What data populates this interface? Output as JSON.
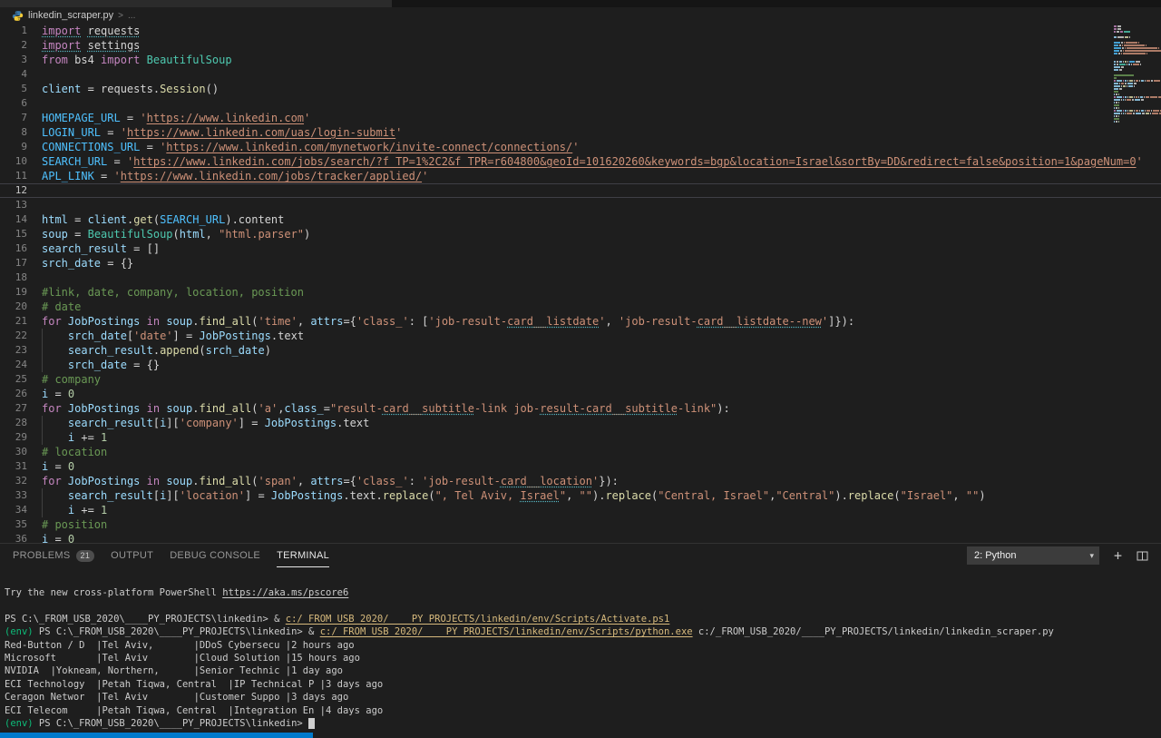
{
  "colors": {
    "accent": "#007acc",
    "kw": "#c586c0",
    "pln": "#d4d4d4",
    "var": "#9cdcfe",
    "const": "#4fc1ff",
    "fn": "#dcdcaa",
    "str": "#ce9178",
    "cmt": "#6a9955",
    "num": "#b5cea8",
    "cls": "#4ec9b0",
    "term_text": "#cccccc",
    "term_yellow": "#d7ba7d",
    "term_green": "#0dbc79"
  },
  "breadcrumb": {
    "file": "linkedin_scraper.py",
    "separator": ">",
    "more": "..."
  },
  "editor": {
    "current_line": 12,
    "lines": [
      [
        [
          "kw sq",
          "import"
        ],
        [
          "pln",
          " "
        ],
        [
          "pln sq",
          "requests"
        ]
      ],
      [
        [
          "kw sq",
          "import"
        ],
        [
          "pln",
          " "
        ],
        [
          "pln sq",
          "settings"
        ]
      ],
      [
        [
          "kw",
          "from"
        ],
        [
          "pln",
          " bs4 "
        ],
        [
          "kw",
          "import"
        ],
        [
          "pln",
          " "
        ],
        [
          "cls",
          "BeautifulSoup"
        ]
      ],
      [],
      [
        [
          "var",
          "client"
        ],
        [
          "pln",
          " = requests."
        ],
        [
          "fn",
          "Session"
        ],
        [
          "pln",
          "()"
        ]
      ],
      [],
      [
        [
          "const",
          "HOMEPAGE_URL"
        ],
        [
          "pln",
          " = "
        ],
        [
          "str",
          "'"
        ],
        [
          "str u",
          "https://www.linkedin.com"
        ],
        [
          "str",
          "'"
        ]
      ],
      [
        [
          "const",
          "LOGIN_URL"
        ],
        [
          "pln",
          " = "
        ],
        [
          "str",
          "'"
        ],
        [
          "str u",
          "https://www.linkedin.com/uas/login-submit"
        ],
        [
          "str",
          "'"
        ]
      ],
      [
        [
          "const",
          "CONNECTIONS_URL"
        ],
        [
          "pln",
          " = "
        ],
        [
          "str",
          "'"
        ],
        [
          "str u",
          "https://www.linkedin.com/mynetwork/invite-connect/connections/"
        ],
        [
          "str",
          "'"
        ]
      ],
      [
        [
          "const",
          "SEARCH_URL"
        ],
        [
          "pln",
          " = "
        ],
        [
          "str",
          "'"
        ],
        [
          "str u",
          "https://www.linkedin.com/jobs/search/?f_TP=1%2C2&f_TPR=r604800&geoId=101620260&keywords=bgp&location=Israel&sortBy=DD&redirect=false&position=1&pageNum=0"
        ],
        [
          "str",
          "'"
        ]
      ],
      [
        [
          "const",
          "APL_LINK"
        ],
        [
          "pln",
          " = "
        ],
        [
          "str",
          "'"
        ],
        [
          "str u",
          "https://www.linkedin.com/jobs/tracker/applied/"
        ],
        [
          "str",
          "'"
        ]
      ],
      [],
      [],
      [
        [
          "var",
          "html"
        ],
        [
          "pln",
          " = "
        ],
        [
          "var",
          "client"
        ],
        [
          "pln",
          "."
        ],
        [
          "fn",
          "get"
        ],
        [
          "pln",
          "("
        ],
        [
          "const",
          "SEARCH_URL"
        ],
        [
          "pln",
          ").content"
        ]
      ],
      [
        [
          "var",
          "soup"
        ],
        [
          "pln",
          " = "
        ],
        [
          "cls",
          "BeautifulSoup"
        ],
        [
          "pln",
          "("
        ],
        [
          "var",
          "html"
        ],
        [
          "pln",
          ", "
        ],
        [
          "str",
          "\"html.parser\""
        ],
        [
          "pln",
          ")"
        ]
      ],
      [
        [
          "var",
          "search_result"
        ],
        [
          "pln",
          " = []"
        ]
      ],
      [
        [
          "var",
          "srch_date"
        ],
        [
          "pln",
          " = {}"
        ]
      ],
      [],
      [
        [
          "cmt",
          "#link, date, company, location, position"
        ]
      ],
      [
        [
          "cmt",
          "# date"
        ]
      ],
      [
        [
          "kw",
          "for"
        ],
        [
          "pln",
          " "
        ],
        [
          "var",
          "JobPostings"
        ],
        [
          "pln",
          " "
        ],
        [
          "kw",
          "in"
        ],
        [
          "pln",
          " "
        ],
        [
          "var",
          "soup"
        ],
        [
          "pln",
          "."
        ],
        [
          "fn",
          "find_all"
        ],
        [
          "pln",
          "("
        ],
        [
          "str",
          "'time'"
        ],
        [
          "pln",
          ", "
        ],
        [
          "var",
          "attrs"
        ],
        [
          "pln",
          "={"
        ],
        [
          "str",
          "'class_'"
        ],
        [
          "pln",
          ": ["
        ],
        [
          "str",
          "'job-result-"
        ],
        [
          "str sq",
          "card__listdate"
        ],
        [
          "str",
          "'"
        ],
        [
          "pln",
          ", "
        ],
        [
          "str",
          "'job-result-"
        ],
        [
          "str sq",
          "card__listdate--new"
        ],
        [
          "str",
          "'"
        ],
        [
          "pln",
          "]}):"
        ]
      ],
      [
        [
          "pln",
          "    "
        ],
        [
          "var",
          "srch_date"
        ],
        [
          "pln",
          "["
        ],
        [
          "str",
          "'date'"
        ],
        [
          "pln",
          "] = "
        ],
        [
          "var",
          "JobPostings"
        ],
        [
          "pln",
          ".text"
        ]
      ],
      [
        [
          "pln",
          "    "
        ],
        [
          "var",
          "search_result"
        ],
        [
          "pln",
          "."
        ],
        [
          "fn",
          "append"
        ],
        [
          "pln",
          "("
        ],
        [
          "var",
          "srch_date"
        ],
        [
          "pln",
          ")"
        ]
      ],
      [
        [
          "pln",
          "    "
        ],
        [
          "var",
          "srch_date"
        ],
        [
          "pln",
          " = {}"
        ]
      ],
      [
        [
          "cmt",
          "# company"
        ]
      ],
      [
        [
          "var",
          "i"
        ],
        [
          "pln",
          " = "
        ],
        [
          "num",
          "0"
        ]
      ],
      [
        [
          "kw",
          "for"
        ],
        [
          "pln",
          " "
        ],
        [
          "var",
          "JobPostings"
        ],
        [
          "pln",
          " "
        ],
        [
          "kw",
          "in"
        ],
        [
          "pln",
          " "
        ],
        [
          "var",
          "soup"
        ],
        [
          "pln",
          "."
        ],
        [
          "fn",
          "find_all"
        ],
        [
          "pln",
          "("
        ],
        [
          "str",
          "'a'"
        ],
        [
          "pln",
          ","
        ],
        [
          "var",
          "class_"
        ],
        [
          "pln",
          "="
        ],
        [
          "str",
          "\"result-"
        ],
        [
          "str sq",
          "card__subtitle"
        ],
        [
          "str",
          "-link job-"
        ],
        [
          "str sq",
          "result-card__subtitle"
        ],
        [
          "str",
          "-link\""
        ],
        [
          "pln",
          "):"
        ]
      ],
      [
        [
          "pln",
          "    "
        ],
        [
          "var",
          "search_result"
        ],
        [
          "pln",
          "["
        ],
        [
          "var",
          "i"
        ],
        [
          "pln",
          "]["
        ],
        [
          "str",
          "'company'"
        ],
        [
          "pln",
          "] = "
        ],
        [
          "var",
          "JobPostings"
        ],
        [
          "pln",
          ".text"
        ]
      ],
      [
        [
          "pln",
          "    "
        ],
        [
          "var",
          "i"
        ],
        [
          "pln",
          " += "
        ],
        [
          "num",
          "1"
        ]
      ],
      [
        [
          "cmt",
          "# location"
        ]
      ],
      [
        [
          "var",
          "i"
        ],
        [
          "pln",
          " = "
        ],
        [
          "num",
          "0"
        ]
      ],
      [
        [
          "kw",
          "for"
        ],
        [
          "pln",
          " "
        ],
        [
          "var",
          "JobPostings"
        ],
        [
          "pln",
          " "
        ],
        [
          "kw",
          "in"
        ],
        [
          "pln",
          " "
        ],
        [
          "var",
          "soup"
        ],
        [
          "pln",
          "."
        ],
        [
          "fn",
          "find_all"
        ],
        [
          "pln",
          "("
        ],
        [
          "str",
          "'span'"
        ],
        [
          "pln",
          ", "
        ],
        [
          "var",
          "attrs"
        ],
        [
          "pln",
          "={"
        ],
        [
          "str",
          "'class_'"
        ],
        [
          "pln",
          ": "
        ],
        [
          "str",
          "'job-result-"
        ],
        [
          "str sq",
          "card__location"
        ],
        [
          "str",
          "'"
        ],
        [
          "pln",
          "}):"
        ]
      ],
      [
        [
          "pln",
          "    "
        ],
        [
          "var",
          "search_result"
        ],
        [
          "pln",
          "["
        ],
        [
          "var",
          "i"
        ],
        [
          "pln",
          "]["
        ],
        [
          "str",
          "'location'"
        ],
        [
          "pln",
          "] = "
        ],
        [
          "var",
          "JobPostings"
        ],
        [
          "pln",
          ".text."
        ],
        [
          "fn",
          "replace"
        ],
        [
          "pln",
          "("
        ],
        [
          "str",
          "\", Tel Aviv, "
        ],
        [
          "str sq",
          "Israel"
        ],
        [
          "str",
          "\""
        ],
        [
          "pln",
          ", "
        ],
        [
          "str",
          "\"\""
        ],
        [
          "pln",
          ")."
        ],
        [
          "fn",
          "replace"
        ],
        [
          "pln",
          "("
        ],
        [
          "str",
          "\"Central, Israel\""
        ],
        [
          "pln",
          ","
        ],
        [
          "str",
          "\"Central\""
        ],
        [
          "pln",
          ")."
        ],
        [
          "fn",
          "replace"
        ],
        [
          "pln",
          "("
        ],
        [
          "str",
          "\"Israel\""
        ],
        [
          "pln",
          ", "
        ],
        [
          "str",
          "\"\""
        ],
        [
          "pln",
          ")"
        ]
      ],
      [
        [
          "pln",
          "    "
        ],
        [
          "var",
          "i"
        ],
        [
          "pln",
          " += "
        ],
        [
          "num",
          "1"
        ]
      ],
      [
        [
          "cmt",
          "# position"
        ]
      ],
      [
        [
          "var",
          "i"
        ],
        [
          "pln",
          " = "
        ],
        [
          "num",
          "0"
        ]
      ]
    ]
  },
  "panel": {
    "tabs": [
      {
        "label": "PROBLEMS",
        "badge": "21",
        "active": false
      },
      {
        "label": "OUTPUT",
        "active": false
      },
      {
        "label": "DEBUG CONSOLE",
        "active": false
      },
      {
        "label": "TERMINAL",
        "active": true
      }
    ],
    "shell_select": "2: Python"
  },
  "terminal": {
    "lines": [
      [
        [
          "t",
          "Try the new cross-platform PowerShell "
        ],
        [
          "t u",
          "https://aka.ms/pscore6"
        ]
      ],
      [],
      [
        [
          "t",
          "PS C:\\_FROM_USB_2020\\____PY_PROJECTS\\linkedin> & "
        ],
        [
          "y u",
          "c:/_FROM_USB_2020/____PY_PROJECTS/linkedin/env/Scripts/Activate.ps1"
        ]
      ],
      [
        [
          "g",
          "(env)"
        ],
        [
          "t",
          " PS C:\\_FROM_USB_2020\\____PY_PROJECTS\\linkedin> & "
        ],
        [
          "y u",
          "c:/_FROM_USB_2020/____PY_PROJECTS/linkedin/env/Scripts/python.exe"
        ],
        [
          "t",
          " c:/_FROM_USB_2020/____PY_PROJECTS/linkedin/linkedin_scraper.py"
        ]
      ],
      [
        [
          "t",
          "Red-Button / D  |Tel Aviv,       |DDoS Cybersecu |2 hours ago"
        ]
      ],
      [
        [
          "t",
          "Microsoft       |Tel Aviv        |Cloud Solution |15 hours ago"
        ]
      ],
      [
        [
          "t",
          "NVIDIA  |Yokneam, Northern,      |Senior Technic |1 day ago"
        ]
      ],
      [
        [
          "t",
          "ECI Technology  |Petah Tiqwa, Central  |IP Technical P |3 days ago"
        ]
      ],
      [
        [
          "t",
          "Ceragon Networ  |Tel Aviv        |Customer Suppo |3 days ago"
        ]
      ],
      [
        [
          "t",
          "ECI Telecom     |Petah Tiqwa, Central  |Integration En |4 days ago"
        ]
      ],
      [
        [
          "g",
          "(env)"
        ],
        [
          "t",
          " PS C:\\_FROM_USB_2020\\____PY_PROJECTS\\linkedin> "
        ],
        [
          "cur",
          " "
        ]
      ]
    ]
  }
}
